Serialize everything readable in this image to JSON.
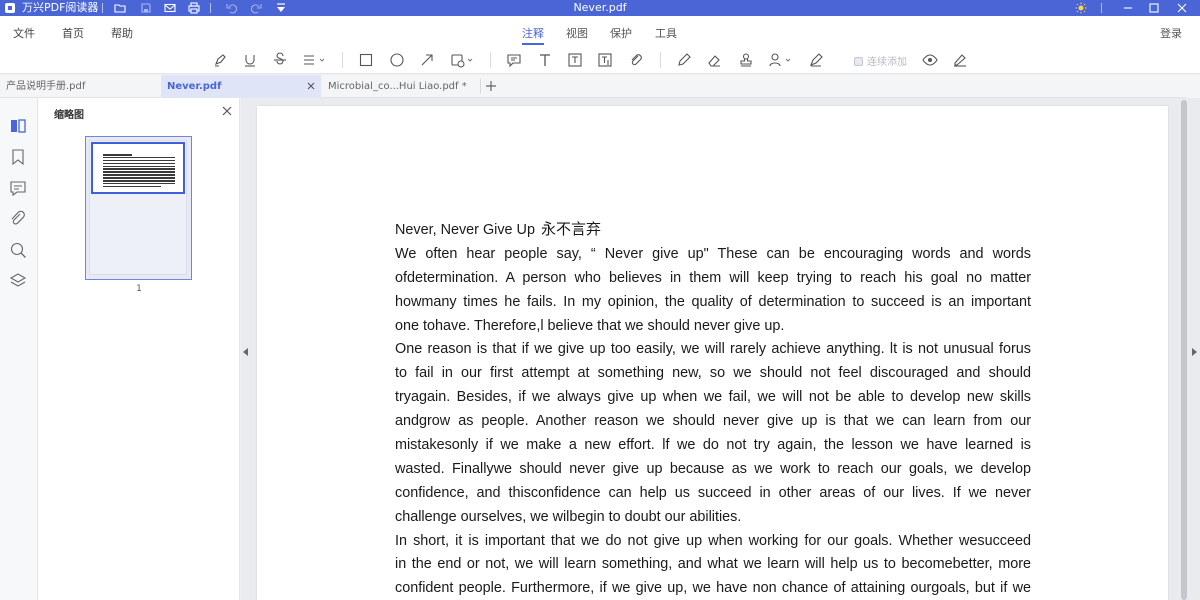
{
  "titlebar": {
    "app_name": "万兴PDF阅读器",
    "document_title": "Never.pdf",
    "bg_color": "#4a65d6"
  },
  "menu": {
    "file": "文件",
    "home": "首页",
    "help": "帮助",
    "login": "登录"
  },
  "ribbon_tabs": [
    "注释",
    "视图",
    "保护",
    "工具"
  ],
  "ribbon_active": "注释",
  "toolbar": {
    "continuous_add_label": "连续添加"
  },
  "tabs": [
    {
      "label": "产品说明手册.pdf",
      "active": false
    },
    {
      "label": "Never.pdf",
      "active": true
    },
    {
      "label": "Microbial_co...Hui Liao.pdf *",
      "active": false
    }
  ],
  "thumbnails": {
    "title": "缩略图",
    "page_number": "1"
  },
  "document": {
    "title": "Never, Never Give Up",
    "title_zh": "永不言弃",
    "lines": [
      {
        "text": "We often hear people say,  “ Never give up\" These can be encouraging words and words",
        "last": false
      },
      {
        "text": "ofdetermination. A person who believes in them will keep trying to reach his goal no matter",
        "last": false
      },
      {
        "text": "howmany times he fails. In my opinion, the quality of determination to succeed is an important",
        "last": false
      },
      {
        "text": "one tohave. Therefore,l believe that we should never give up.",
        "last": true
      },
      {
        "text": "One reason is that if we give up too easily, we will rarely achieve anything. lt is not unusual forus",
        "last": false
      },
      {
        "text": "to fail in our first attempt at something new, so we should not feel discouraged and should",
        "last": false
      },
      {
        "text": "tryagain. Besides, if we always give up when we fail, we will not be able to develop new skills",
        "last": false
      },
      {
        "text": "andgrow as people. Another reason we should never give up is that we can learn from our",
        "last": false
      },
      {
        "text": "mistakesonly if we make a new effort. lf we do not try again, the lesson we have learned is",
        "last": false
      },
      {
        "text": "wasted. Finallywe should never give up because as we work to reach our goals, we develop",
        "last": false
      },
      {
        "text": "confidence, and thisconfidence can help us succeed in other areas of our lives. If we never",
        "last": false
      },
      {
        "text": "challenge ourselves, we wilbegin to doubt our abilities.",
        "last": true
      },
      {
        "text": "In short, it is important that we do not give up when working for our goals. Whether wesucceed",
        "last": false
      },
      {
        "text": "in the end or not, we will learn something, and what we learn will help us to becomebetter, more",
        "last": false
      },
      {
        "text": "confident people. Furthermore, if we give up, we have non chance of attaining ourgoals, but if we",
        "last": false
      }
    ]
  }
}
